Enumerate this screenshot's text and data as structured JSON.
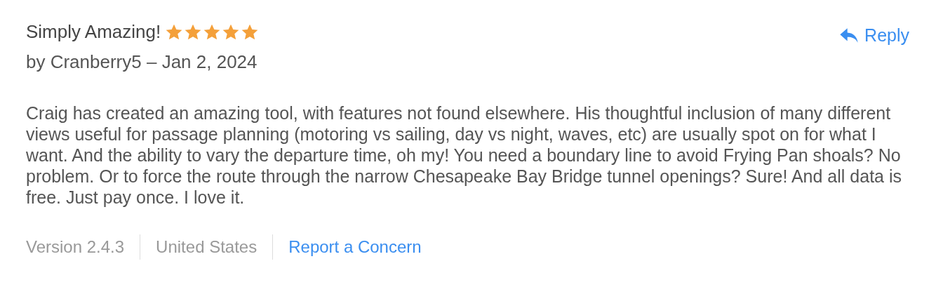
{
  "review": {
    "title": "Simply Amazing!",
    "stars": 5,
    "byline": "by Cranberry5 – Jan 2, 2024",
    "reply": "Reply",
    "body": "Craig has created an amazing tool, with features not found elsewhere. His thoughtful inclusion of many different views useful for passage planning (motoring vs sailing, day vs night, waves, etc) are usually spot on for what I want. And the ability to vary the departure time, oh my! You need a boundary line to avoid Frying Pan shoals? No problem. Or to force the route through the narrow Chesapeake Bay Bridge tunnel openings? Sure! And all data is free. Just pay once. I love it.",
    "footer": [
      {
        "kind": "text",
        "label": "Version 2.4.3"
      },
      {
        "kind": "text",
        "label": "United States"
      },
      {
        "kind": "link",
        "label": "Report a Concern"
      }
    ]
  }
}
